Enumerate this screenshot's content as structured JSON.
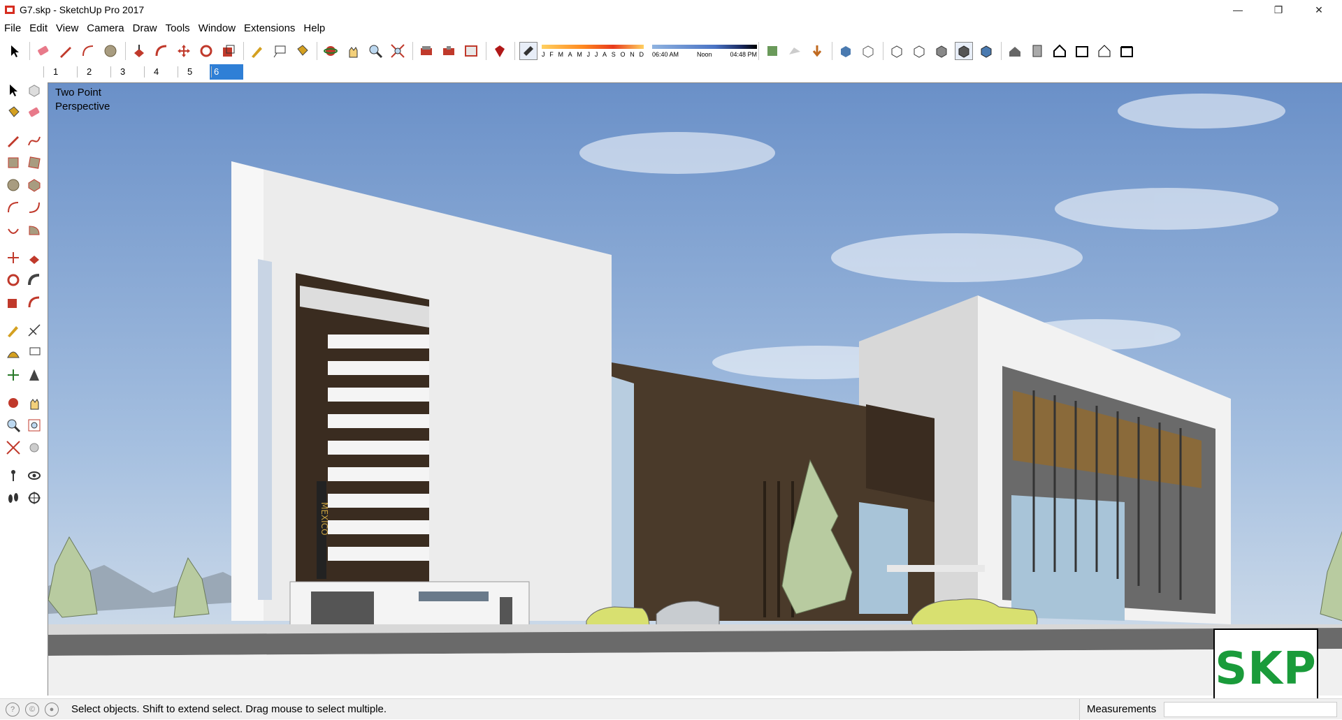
{
  "window": {
    "title": "G7.skp - SketchUp Pro 2017",
    "minimize_glyph": "—",
    "restore_glyph": "❐",
    "close_glyph": "✕"
  },
  "menu": [
    "File",
    "Edit",
    "View",
    "Camera",
    "Draw",
    "Tools",
    "Window",
    "Extensions",
    "Help"
  ],
  "shadow_settings": {
    "months": [
      "J",
      "F",
      "M",
      "A",
      "M",
      "J",
      "J",
      "A",
      "S",
      "O",
      "N",
      "D"
    ],
    "time_start": "06:40 AM",
    "time_mid": "Noon",
    "time_end": "04:48 PM"
  },
  "scene_tabs": [
    "1",
    "2",
    "3",
    "4",
    "5",
    "6"
  ],
  "active_tab": "6",
  "viewport": {
    "view_label": "Two Point\nPerspective",
    "building_sign": "MEXICO"
  },
  "logo": {
    "text": "SKP",
    "color": "#1a9b3a"
  },
  "status": {
    "message": "Select objects. Shift to extend select. Drag mouse to select multiple.",
    "measurements_label": "Measurements",
    "measurements_value": ""
  },
  "colors": {
    "accent": "#2f7fd6",
    "sky_top": "#6a90c8",
    "facade_dark": "#4a3a2a"
  }
}
